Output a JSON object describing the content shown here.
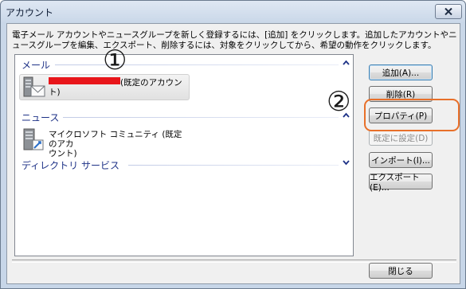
{
  "window": {
    "title": "アカウント"
  },
  "description": "電子メール アカウントやニュースグループを新しく登録するには、[追加] をクリックします。追加したアカウントやニュースグループを編集、エクスポート、削除するには、対象をクリックしてから、希望の動作をクリックします。",
  "groups": {
    "mail": {
      "label": "メール",
      "chevron": "chevron-up-icon"
    },
    "news": {
      "label": "ニュース",
      "chevron": "chevron-up-icon"
    },
    "directory": {
      "label": "ディレクトリ サービス",
      "chevron": "chevron-down-icon"
    }
  },
  "accounts": {
    "mail_account": {
      "label_suffix": "(既定のアカウン",
      "label_line2": "ト)"
    },
    "news_account": {
      "label_line1": "マイクロソフト コミュニティ (既定のアカ",
      "label_line2": "ウント)"
    }
  },
  "buttons": {
    "add": "追加(A)...",
    "remove": "削除(R)",
    "properties": "プロパティ(P)",
    "set_default": "既定に設定(D)",
    "import": "インポート(I)...",
    "export": "エクスポート(E)...",
    "close": "閉じる"
  },
  "annotations": {
    "marker1": "①",
    "marker2": "②",
    "ring_color": "#e8702a"
  }
}
